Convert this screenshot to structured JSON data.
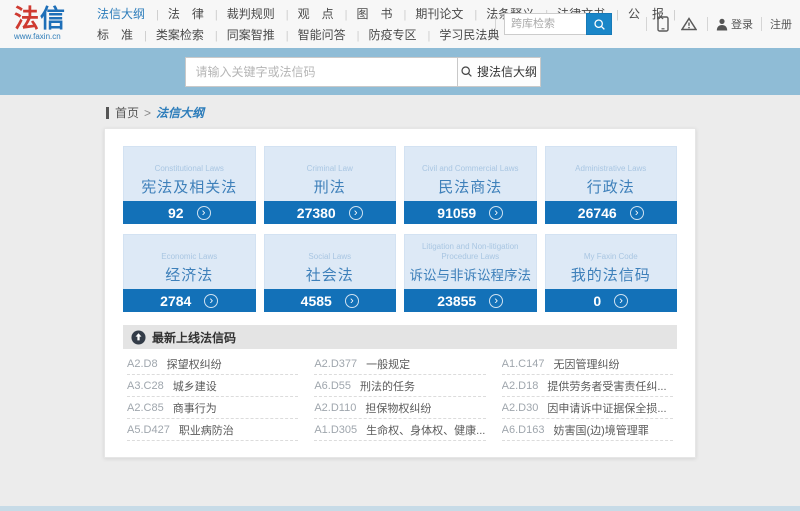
{
  "logo": {
    "char1": "法",
    "char2": "信",
    "url": "www.faxin.cn"
  },
  "nav": {
    "row1": [
      {
        "label": "法信大纲",
        "active": true
      },
      {
        "label": "法　律"
      },
      {
        "label": "裁判规则"
      },
      {
        "label": "观　点"
      },
      {
        "label": "图　书"
      },
      {
        "label": "期刊论文"
      },
      {
        "label": "法条释义"
      },
      {
        "label": "法律文书"
      },
      {
        "label": "公　报"
      }
    ],
    "row2": [
      {
        "label": "标　准"
      },
      {
        "label": "类案检索"
      },
      {
        "label": "同案智推"
      },
      {
        "label": "智能问答"
      },
      {
        "label": "防疫专区"
      },
      {
        "label": "学习民法典"
      }
    ]
  },
  "topbar": {
    "search_placeholder": "跨库检索",
    "login_label": "登录",
    "register_label": "注册"
  },
  "hero_search": {
    "placeholder": "请输入关键字或法信码",
    "button_label": "搜法信大纲"
  },
  "breadcrumb": {
    "home": "首页",
    "separator": ">",
    "current": "法信大纲"
  },
  "cards": [
    {
      "en": "Constitutional Laws",
      "zh": "宪法及相关法",
      "count": "92"
    },
    {
      "en": "Criminal Law",
      "zh": "刑法",
      "count": "27380"
    },
    {
      "en": "Civil and Commercial Laws",
      "zh": "民法商法",
      "count": "91059"
    },
    {
      "en": "Administrative Laws",
      "zh": "行政法",
      "count": "26746"
    },
    {
      "en": "Economic Laws",
      "zh": "经济法",
      "count": "2784"
    },
    {
      "en": "Social Laws",
      "zh": "社会法",
      "count": "4585"
    },
    {
      "en": "Litigation and Non-litigation Procedure Laws",
      "zh": "诉讼与非诉讼程序法",
      "count": "23855"
    },
    {
      "en": "My Faxin Code",
      "zh": "我的法信码",
      "count": "0"
    }
  ],
  "latest": {
    "title": "最新上线法信码",
    "items": [
      {
        "code": "A2.D8",
        "title": "探望权纠纷"
      },
      {
        "code": "A2.D377",
        "title": "一般规定"
      },
      {
        "code": "A1.C147",
        "title": "无因管理纠纷"
      },
      {
        "code": "A3.C28",
        "title": "城乡建设"
      },
      {
        "code": "A6.D55",
        "title": "刑法的任务"
      },
      {
        "code": "A2.D18",
        "title": "提供劳务者受害责任纠..."
      },
      {
        "code": "A2.C85",
        "title": "商事行为"
      },
      {
        "code": "A2.D110",
        "title": "担保物权纠纷"
      },
      {
        "code": "A2.D30",
        "title": "因申请诉中证据保全损..."
      },
      {
        "code": "A5.D427",
        "title": "职业病防治"
      },
      {
        "code": "A1.D305",
        "title": "生命权、身体权、健康..."
      },
      {
        "code": "A6.D163",
        "title": "妨害国(边)境管理罪"
      }
    ]
  },
  "icons": {
    "chevron": "›"
  },
  "colors": {
    "accent_blue": "#1371b8",
    "band_blue": "#8fbcd6",
    "card_light_blue": "#dde9f6",
    "logo_red": "#cf3a31",
    "logo_blue": "#1e6fb8"
  }
}
